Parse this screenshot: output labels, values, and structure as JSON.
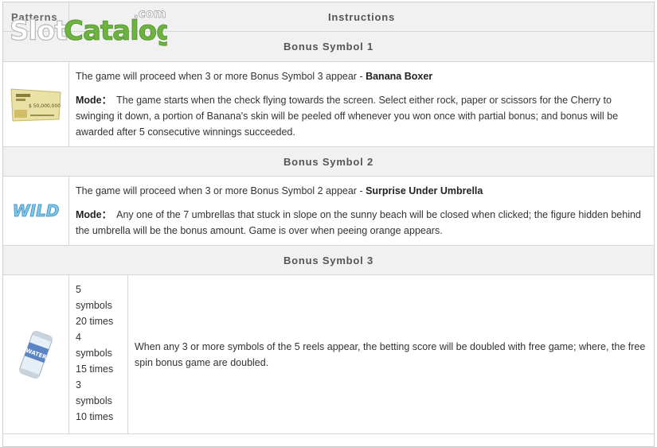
{
  "header": {
    "patterns_label": "Patterns",
    "instructions_label": "Instructions"
  },
  "logo": {
    "slot": "Slot",
    "catalog": "Catalog",
    "com": ".com"
  },
  "sections": [
    {
      "title": "Bonus Symbol 1",
      "proceed_text": "The game will proceed when 3 or more Bonus Symbol 3 appear - ",
      "bonus_name": "Banana Boxer",
      "mode_label": "Mode：",
      "mode_text": "The game starts when the check flying towards the screen. Select either rock, paper or scissors for the Cherry to swinging it down, a portion of Banana's skin will be peeled off whenever you won once with partial bonus; and bonus will be awarded after 5 consecutive winnings succeeded.",
      "icon": "check-ticket-icon",
      "check_amount": "$ 50,000,000"
    },
    {
      "title": "Bonus Symbol 2",
      "proceed_text": "The game will proceed when 3 or more Bonus Symbol 2 appear - ",
      "bonus_name": "Surprise Under Umbrella",
      "mode_label": "Mode：",
      "mode_text": "Any one of the 7 umbrellas that stuck in slope on the sunny beach will be closed when clicked; the figure hidden behind the umbrella will be the bonus amount. Game is over when peeing orange appears.",
      "icon": "wild-symbol-icon",
      "wild_text": "WILD"
    },
    {
      "title": "Bonus Symbol 3",
      "counts": [
        "5",
        "symbols",
        "20 times",
        "4",
        "symbols",
        "15 times",
        "3",
        "symbols",
        "10 times"
      ],
      "description": "When any 3 or more symbols of the 5 reels appear, the betting score will be doubled with free game; where, the free spin bonus game are doubled.",
      "icon": "water-can-icon",
      "can_text": "WATER"
    }
  ],
  "colors": {
    "header_bg": "#f1f1f1",
    "border": "#d6d6d6",
    "logo_green": "#6db33f",
    "logo_gray": "#b9b9b9"
  }
}
